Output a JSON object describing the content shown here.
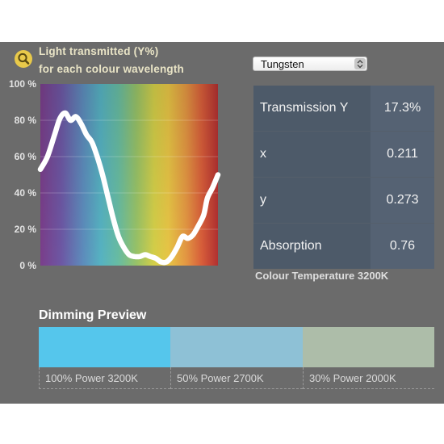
{
  "chart": {
    "title_line1": "Light transmitted (Y%)",
    "title_line2": "for each colour wavelength",
    "zoom_icon": "magnifier-icon"
  },
  "chart_data": {
    "type": "line",
    "title": "Light transmitted (Y%) for each colour wavelength",
    "xlabel": "",
    "ylabel": "",
    "ylim": [
      0,
      100
    ],
    "yticks": [
      "100 %",
      "80 %",
      "60 %",
      "40 %",
      "20 %",
      "0 %"
    ],
    "x_description": "visible spectrum, violet to red",
    "series": [
      {
        "color": "#ffffff",
        "x": [
          0,
          0.04,
          0.08,
          0.11,
          0.14,
          0.17,
          0.2,
          0.23,
          0.26,
          0.29,
          0.32,
          0.35,
          0.38,
          0.41,
          0.44,
          0.47,
          0.5,
          0.53,
          0.56,
          0.59,
          0.62,
          0.65,
          0.68,
          0.71,
          0.74,
          0.77,
          0.8,
          0.83,
          0.86,
          0.89,
          0.92,
          0.94,
          0.97,
          1.0
        ],
        "y": [
          53,
          60,
          72,
          81,
          84,
          80,
          82,
          78,
          72,
          68,
          60,
          50,
          38,
          26,
          16,
          10,
          6,
          5,
          5,
          6,
          5,
          4,
          2,
          2,
          5,
          10,
          16,
          15,
          17,
          22,
          28,
          37,
          43,
          50
        ]
      }
    ]
  },
  "illuminant": {
    "selected": "Tungsten"
  },
  "results": {
    "rows": [
      {
        "label": "Transmission Y",
        "value": "17.3%"
      },
      {
        "label": "x",
        "value": "0.211"
      },
      {
        "label": "y",
        "value": "0.273"
      },
      {
        "label": "Absorption",
        "value": "0.76"
      }
    ],
    "colour_temperature": "Colour Temperature 3200K"
  },
  "dimming": {
    "title": "Dimming Preview",
    "swatches": [
      {
        "color": "#55c6ec",
        "label": "100% Power 3200K"
      },
      {
        "color": "#8ec1d6",
        "label": "50% Power 2700K"
      },
      {
        "color": "#adbda9",
        "label": "30% Power 2000K"
      }
    ]
  }
}
